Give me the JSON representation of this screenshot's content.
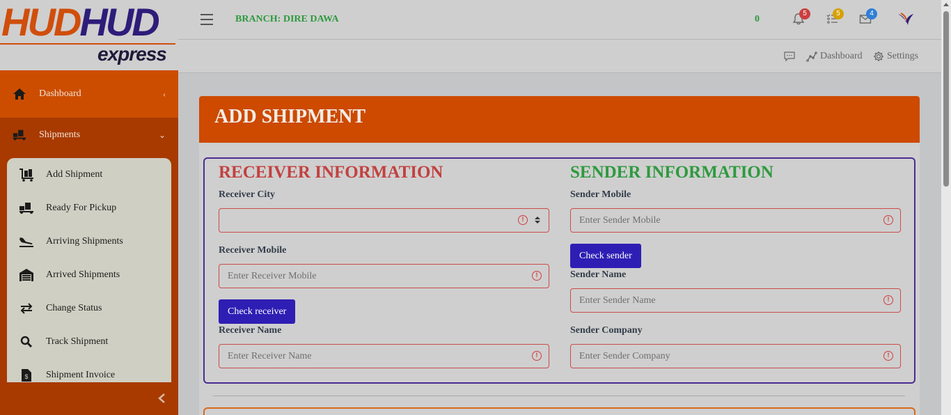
{
  "logo": {
    "brand_part1": "HUD",
    "brand_part2": "HUD",
    "tagline": "express"
  },
  "sidebar": {
    "dashboard_label": "Dashboard",
    "shipments_label": "Shipments",
    "items": [
      {
        "label": "Add Shipment",
        "icon": "luggage-cart-icon"
      },
      {
        "label": "Ready For Pickup",
        "icon": "truck-loading-icon"
      },
      {
        "label": "Arriving Shipments",
        "icon": "plane-arrival-icon"
      },
      {
        "label": "Arrived Shipments",
        "icon": "warehouse-icon"
      },
      {
        "label": "Change Status",
        "icon": "exchange-icon"
      },
      {
        "label": "Track Shipment",
        "icon": "search-icon"
      },
      {
        "label": "Shipment Invoice",
        "icon": "invoice-icon"
      }
    ]
  },
  "topbar": {
    "branch_label": "BRANCH: DIRE DAWA",
    "counter": "0",
    "notifications_count": "5",
    "tasks_count": "5",
    "messages_count": "4"
  },
  "subbar": {
    "dashboard_label": "Dashboard",
    "settings_label": "Settings"
  },
  "page": {
    "title": "ADD SHIPMENT"
  },
  "receiver": {
    "title": "RECEIVER INFORMATION",
    "city_label": "Receiver City",
    "city_value": "",
    "mobile_label": "Receiver Mobile",
    "mobile_placeholder": "Enter Receiver Mobile",
    "check_button": "Check receiver",
    "name_label": "Receiver Name",
    "name_placeholder": "Enter Receiver Name"
  },
  "sender": {
    "title": "SENDER INFORMATION",
    "mobile_label": "Sender Mobile",
    "mobile_placeholder": "Enter Sender Mobile",
    "check_button": "Check sender",
    "name_label": "Sender Name",
    "name_placeholder": "Enter Sender Name",
    "company_label": "Sender Company",
    "company_placeholder": "Enter Sender Company"
  },
  "colors": {
    "brand_orange": "#cd4a00",
    "sidebar_dark": "#a83a00",
    "brand_purple": "#2e1c7a",
    "receiver_red": "#c2413f",
    "sender_green": "#2e9a3e",
    "button_blue": "#2e1eb4",
    "error_red": "#d23c3c"
  }
}
